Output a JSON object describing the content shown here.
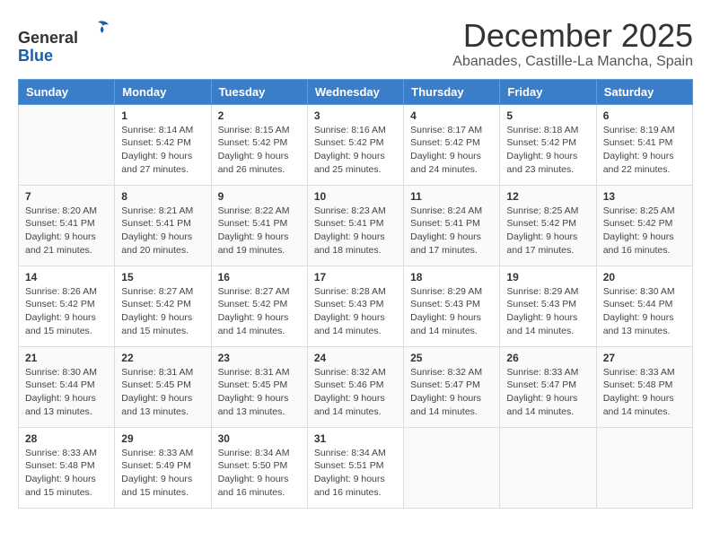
{
  "header": {
    "logo_general": "General",
    "logo_blue": "Blue",
    "title": "December 2025",
    "subtitle": "Abanades, Castille-La Mancha, Spain"
  },
  "calendar": {
    "days_of_week": [
      "Sunday",
      "Monday",
      "Tuesday",
      "Wednesday",
      "Thursday",
      "Friday",
      "Saturday"
    ],
    "weeks": [
      [
        {
          "day": "",
          "info": ""
        },
        {
          "day": "1",
          "info": "Sunrise: 8:14 AM\nSunset: 5:42 PM\nDaylight: 9 hours\nand 27 minutes."
        },
        {
          "day": "2",
          "info": "Sunrise: 8:15 AM\nSunset: 5:42 PM\nDaylight: 9 hours\nand 26 minutes."
        },
        {
          "day": "3",
          "info": "Sunrise: 8:16 AM\nSunset: 5:42 PM\nDaylight: 9 hours\nand 25 minutes."
        },
        {
          "day": "4",
          "info": "Sunrise: 8:17 AM\nSunset: 5:42 PM\nDaylight: 9 hours\nand 24 minutes."
        },
        {
          "day": "5",
          "info": "Sunrise: 8:18 AM\nSunset: 5:42 PM\nDaylight: 9 hours\nand 23 minutes."
        },
        {
          "day": "6",
          "info": "Sunrise: 8:19 AM\nSunset: 5:41 PM\nDaylight: 9 hours\nand 22 minutes."
        }
      ],
      [
        {
          "day": "7",
          "info": "Sunrise: 8:20 AM\nSunset: 5:41 PM\nDaylight: 9 hours\nand 21 minutes."
        },
        {
          "day": "8",
          "info": "Sunrise: 8:21 AM\nSunset: 5:41 PM\nDaylight: 9 hours\nand 20 minutes."
        },
        {
          "day": "9",
          "info": "Sunrise: 8:22 AM\nSunset: 5:41 PM\nDaylight: 9 hours\nand 19 minutes."
        },
        {
          "day": "10",
          "info": "Sunrise: 8:23 AM\nSunset: 5:41 PM\nDaylight: 9 hours\nand 18 minutes."
        },
        {
          "day": "11",
          "info": "Sunrise: 8:24 AM\nSunset: 5:41 PM\nDaylight: 9 hours\nand 17 minutes."
        },
        {
          "day": "12",
          "info": "Sunrise: 8:25 AM\nSunset: 5:42 PM\nDaylight: 9 hours\nand 17 minutes."
        },
        {
          "day": "13",
          "info": "Sunrise: 8:25 AM\nSunset: 5:42 PM\nDaylight: 9 hours\nand 16 minutes."
        }
      ],
      [
        {
          "day": "14",
          "info": "Sunrise: 8:26 AM\nSunset: 5:42 PM\nDaylight: 9 hours\nand 15 minutes."
        },
        {
          "day": "15",
          "info": "Sunrise: 8:27 AM\nSunset: 5:42 PM\nDaylight: 9 hours\nand 15 minutes."
        },
        {
          "day": "16",
          "info": "Sunrise: 8:27 AM\nSunset: 5:42 PM\nDaylight: 9 hours\nand 14 minutes."
        },
        {
          "day": "17",
          "info": "Sunrise: 8:28 AM\nSunset: 5:43 PM\nDaylight: 9 hours\nand 14 minutes."
        },
        {
          "day": "18",
          "info": "Sunrise: 8:29 AM\nSunset: 5:43 PM\nDaylight: 9 hours\nand 14 minutes."
        },
        {
          "day": "19",
          "info": "Sunrise: 8:29 AM\nSunset: 5:43 PM\nDaylight: 9 hours\nand 14 minutes."
        },
        {
          "day": "20",
          "info": "Sunrise: 8:30 AM\nSunset: 5:44 PM\nDaylight: 9 hours\nand 13 minutes."
        }
      ],
      [
        {
          "day": "21",
          "info": "Sunrise: 8:30 AM\nSunset: 5:44 PM\nDaylight: 9 hours\nand 13 minutes."
        },
        {
          "day": "22",
          "info": "Sunrise: 8:31 AM\nSunset: 5:45 PM\nDaylight: 9 hours\nand 13 minutes."
        },
        {
          "day": "23",
          "info": "Sunrise: 8:31 AM\nSunset: 5:45 PM\nDaylight: 9 hours\nand 13 minutes."
        },
        {
          "day": "24",
          "info": "Sunrise: 8:32 AM\nSunset: 5:46 PM\nDaylight: 9 hours\nand 14 minutes."
        },
        {
          "day": "25",
          "info": "Sunrise: 8:32 AM\nSunset: 5:47 PM\nDaylight: 9 hours\nand 14 minutes."
        },
        {
          "day": "26",
          "info": "Sunrise: 8:33 AM\nSunset: 5:47 PM\nDaylight: 9 hours\nand 14 minutes."
        },
        {
          "day": "27",
          "info": "Sunrise: 8:33 AM\nSunset: 5:48 PM\nDaylight: 9 hours\nand 14 minutes."
        }
      ],
      [
        {
          "day": "28",
          "info": "Sunrise: 8:33 AM\nSunset: 5:48 PM\nDaylight: 9 hours\nand 15 minutes."
        },
        {
          "day": "29",
          "info": "Sunrise: 8:33 AM\nSunset: 5:49 PM\nDaylight: 9 hours\nand 15 minutes."
        },
        {
          "day": "30",
          "info": "Sunrise: 8:34 AM\nSunset: 5:50 PM\nDaylight: 9 hours\nand 16 minutes."
        },
        {
          "day": "31",
          "info": "Sunrise: 8:34 AM\nSunset: 5:51 PM\nDaylight: 9 hours\nand 16 minutes."
        },
        {
          "day": "",
          "info": ""
        },
        {
          "day": "",
          "info": ""
        },
        {
          "day": "",
          "info": ""
        }
      ]
    ]
  }
}
